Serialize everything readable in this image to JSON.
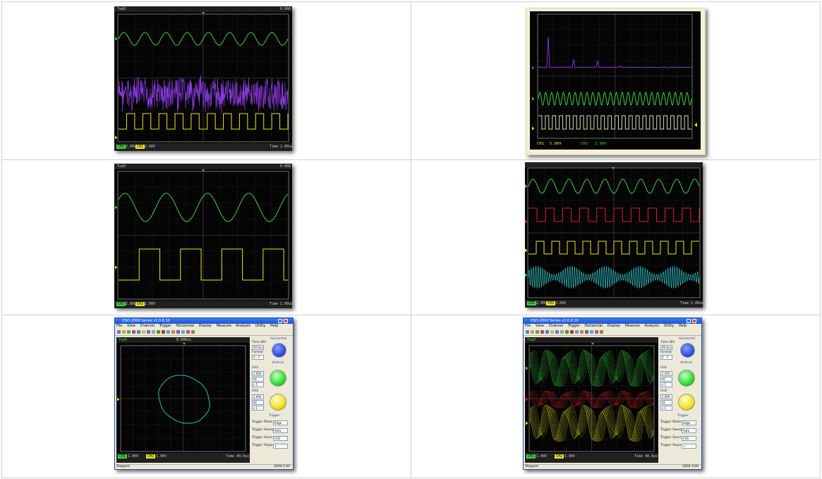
{
  "panel1": {
    "header_left": "TopD",
    "header_right": "0.000",
    "footer_ch1": "CH1",
    "footer_ch1_val": "2.00V",
    "footer_ch2": "CH2",
    "footer_ch2_val": "2.00V",
    "footer_time": "Time 1.00us"
  },
  "panel2": {
    "footer_ch1": "CH1",
    "footer_ch1_val": "5.00V",
    "footer_ch2": "CH2",
    "footer_ch2_val": "2.00V"
  },
  "panel3": {
    "header_left": "TopD",
    "header_right": "0.000",
    "footer_ch1": "CH1",
    "footer_ch1_val": "2.00V",
    "footer_ch2": "CH2",
    "footer_ch2_val": "2.00V",
    "footer_time": "Time 1.00us"
  },
  "panel4": {
    "footer_ch1": "CH1",
    "footer_ch1_val": "2.00V",
    "footer_ch2": "CH2",
    "footer_ch2_val": "2.00V",
    "footer_time": "Time 1.00us"
  },
  "app": {
    "title": "DSO-2000 Series v1.0.6.10",
    "menu": [
      "File",
      "View",
      "Channel",
      "Trigger",
      "Horizontal",
      "Display",
      "Measure",
      "Analysis",
      "Utility",
      "Help"
    ],
    "scope_header": "TopD",
    "scope_header_mid": "0.000us",
    "timebase_label": "Time DIV",
    "timebase_value": "40.0us",
    "format_label": "Format",
    "format_value": "X - Y",
    "horizontal_header": "Horizontal",
    "vertical_header": "Vertical",
    "ch1_label": "CH1",
    "ch1_volt": "1.00V",
    "ch1_coupling": "AC",
    "ch1_probe": "x 1",
    "ch2_label": "CH2",
    "ch2_volt": "1.00V",
    "ch2_coupling": "AC",
    "ch2_probe": "x 1",
    "trigger_header": "Trigger",
    "trigger_mode_label": "Trigger Mode",
    "trigger_mode": "Edge",
    "trigger_sweep_label": "Trigger Sweep",
    "trigger_sweep": "Auto",
    "trigger_source_label": "Trigger Source",
    "trigger_source": "CH1",
    "trigger_slope_label": "Trigger Slope",
    "trigger_slope": "+",
    "footer_ch1": "CH1",
    "footer_ch1_val": "1.00V",
    "footer_ch2": "CH2",
    "footer_ch2_val": "1.00V",
    "footer_time": "Time 40.0us",
    "status_left": "Stopped",
    "status_right": "2004 0.00"
  },
  "colors": {
    "ch1_green": "#3cd23c",
    "ch2_yellow": "#e6e628",
    "math_purple": "#8a3adf",
    "ref_red": "#e02020",
    "cyan": "#2fbcbc",
    "grid": "#5a5a5a",
    "knob_blue": "#2a4ee8",
    "knob_green": "#2edc2e",
    "knob_yellow": "#f2e21c"
  }
}
